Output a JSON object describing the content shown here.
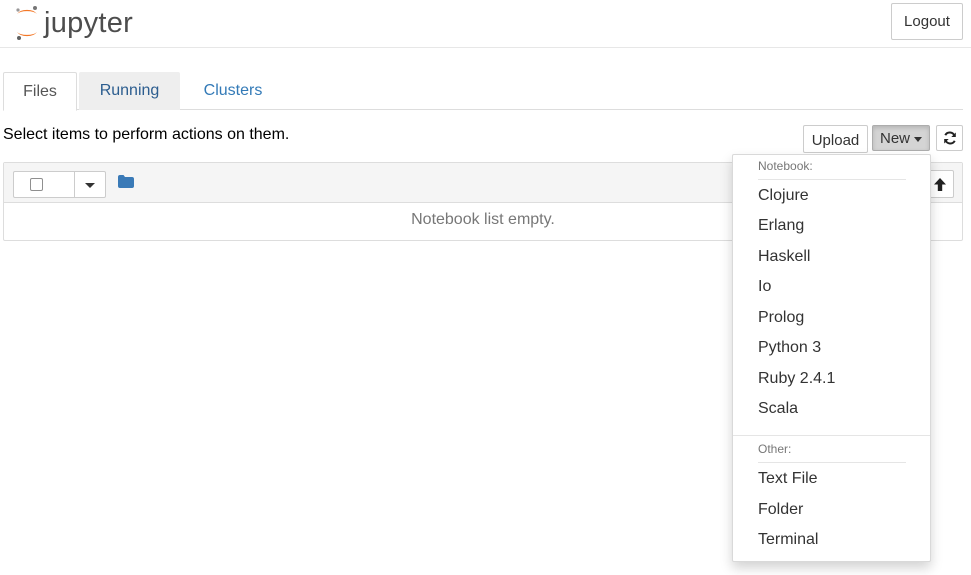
{
  "header": {
    "logo_text": "jupyter",
    "logout_label": "Logout"
  },
  "tabs": [
    {
      "label": "Files"
    },
    {
      "label": "Running"
    },
    {
      "label": "Clusters"
    }
  ],
  "toolbar": {
    "hint": "Select items to perform actions on them.",
    "upload_label": "Upload",
    "new_label": "New",
    "refresh_icon": "refresh-icon"
  },
  "list": {
    "empty_text": "Notebook list empty.",
    "folder_icon": "folder-icon",
    "sort_icon": "arrow-up-icon"
  },
  "new_menu": {
    "notebook_header": "Notebook:",
    "kernels": [
      "Clojure",
      "Erlang",
      "Haskell",
      "Io",
      "Prolog",
      "Python 3",
      "Ruby 2.4.1",
      "Scala"
    ],
    "other_header": "Other:",
    "other_items": [
      "Text File",
      "Folder",
      "Terminal"
    ]
  },
  "colors": {
    "brand_orange": "#f37726",
    "link_blue": "#337ab7",
    "folder_blue": "#3a7ab7"
  }
}
